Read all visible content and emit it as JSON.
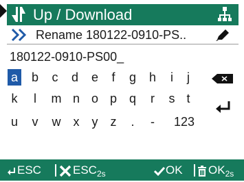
{
  "title_bar": {
    "title": "Up / Download",
    "colors": {
      "background": "#167a5c",
      "text": "#ffffff"
    },
    "icons": [
      "transfer-arrows-icon",
      "network-tree-icon"
    ]
  },
  "rename": {
    "label": "Rename 180122-0910-PS..",
    "icons": [
      "double-chevron-icon",
      "pencil-icon"
    ]
  },
  "filename_field": {
    "value": "180122-0910-PS00_"
  },
  "keyboard": {
    "selected": "a",
    "selected_color": "#1f5aa8",
    "rows": [
      [
        "a",
        "b",
        "c",
        "d",
        "e",
        "f",
        "g",
        "h",
        "i",
        "j"
      ],
      [
        "k",
        "l",
        "m",
        "n",
        "o",
        "p",
        "q",
        "r",
        "s",
        "t"
      ],
      [
        "u",
        "v",
        "w",
        "x",
        "y",
        "z",
        ".",
        "-",
        "123"
      ]
    ],
    "icons": [
      "backspace-icon",
      "enter-icon"
    ]
  },
  "footer": {
    "esc_label": "ESC",
    "esc2_label": "ESC",
    "esc2_sub": "2s",
    "ok_label": "OK",
    "ok2_label": "OK",
    "ok2_sub": "2s",
    "icons": [
      "return-icon",
      "cross-icon",
      "check-icon",
      "trash-icon"
    ]
  }
}
